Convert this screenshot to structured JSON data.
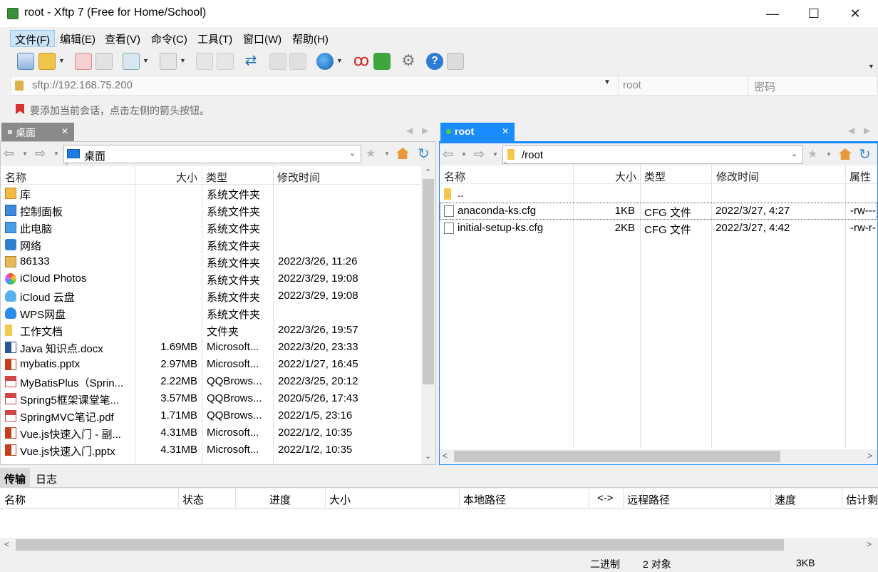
{
  "window": {
    "title": "root - Xftp 7 (Free for Home/School)"
  },
  "menu": [
    "文件(F)",
    "编辑(E)",
    "查看(V)",
    "命令(C)",
    "工具(T)",
    "窗口(W)",
    "帮助(H)"
  ],
  "address": {
    "url": "sftp://192.168.75.200",
    "user_placeholder": "root",
    "password_placeholder": "密码"
  },
  "hint": "要添加当前会话，点击左侧的箭头按钮。",
  "left": {
    "tab": "桌面",
    "path": "桌面",
    "columns": [
      "名称",
      "大小",
      "类型",
      "修改时间"
    ],
    "rows": [
      {
        "name": "库",
        "size": "",
        "type": "系统文件夹",
        "time": "",
        "icon": "library-icon"
      },
      {
        "name": "控制面板",
        "size": "",
        "type": "系统文件夹",
        "time": "",
        "icon": "control-panel-icon"
      },
      {
        "name": "此电脑",
        "size": "",
        "type": "系统文件夹",
        "time": "",
        "icon": "computer-icon"
      },
      {
        "name": "网络",
        "size": "",
        "type": "系统文件夹",
        "time": "",
        "icon": "network-icon"
      },
      {
        "name": "86133",
        "size": "",
        "type": "系统文件夹",
        "time": "2022/3/26, 11:26",
        "icon": "user-folder-icon"
      },
      {
        "name": "iCloud Photos",
        "size": "",
        "type": "系统文件夹",
        "time": "2022/3/29, 19:08",
        "icon": "icloud-photos-icon"
      },
      {
        "name": "iCloud 云盘",
        "size": "",
        "type": "系统文件夹",
        "time": "2022/3/29, 19:08",
        "icon": "icloud-drive-icon"
      },
      {
        "name": "WPS网盘",
        "size": "",
        "type": "系统文件夹",
        "time": "",
        "icon": "wps-cloud-icon"
      },
      {
        "name": "工作文档",
        "size": "",
        "type": "文件夹",
        "time": "2022/3/26, 19:57",
        "icon": "folder-icon"
      },
      {
        "name": "Java 知识点.docx",
        "size": "1.69MB",
        "type": "Microsoft...",
        "time": "2022/3/20, 23:33",
        "icon": "word-file-icon"
      },
      {
        "name": "mybatis.pptx",
        "size": "2.97MB",
        "type": "Microsoft...",
        "time": "2022/1/27, 16:45",
        "icon": "ppt-file-icon"
      },
      {
        "name": "MyBatisPlus（Sprin...",
        "size": "2.22MB",
        "type": "QQBrows...",
        "time": "2022/3/25, 20:12",
        "icon": "pdf-file-icon"
      },
      {
        "name": "Spring5框架课堂笔...",
        "size": "3.57MB",
        "type": "QQBrows...",
        "time": "2020/5/26, 17:43",
        "icon": "pdf-file-icon"
      },
      {
        "name": "SpringMVC笔记.pdf",
        "size": "1.71MB",
        "type": "QQBrows...",
        "time": "2022/1/5, 23:16",
        "icon": "pdf-file-icon"
      },
      {
        "name": "Vue.js快速入门 - 副...",
        "size": "4.31MB",
        "type": "Microsoft...",
        "time": "2022/1/2, 10:35",
        "icon": "ppt-file-icon"
      },
      {
        "name": "Vue.js快速入门.pptx",
        "size": "4.31MB",
        "type": "Microsoft...",
        "time": "2022/1/2, 10:35",
        "icon": "ppt-file-icon"
      }
    ]
  },
  "right": {
    "tab": "root",
    "path": "/root",
    "columns": [
      "名称",
      "大小",
      "类型",
      "修改时间",
      "属性"
    ],
    "rows": [
      {
        "name": "..",
        "size": "",
        "type": "",
        "time": "",
        "attr": "",
        "icon": "folder-icon"
      },
      {
        "name": "anaconda-ks.cfg",
        "size": "1KB",
        "type": "CFG 文件",
        "time": "2022/3/27, 4:27",
        "attr": "-rw---",
        "icon": "file-icon"
      },
      {
        "name": "initial-setup-ks.cfg",
        "size": "2KB",
        "type": "CFG 文件",
        "time": "2022/3/27, 4:42",
        "attr": "-rw-r-",
        "icon": "file-icon"
      }
    ]
  },
  "transfer": {
    "tabs": [
      "传输",
      "日志"
    ],
    "columns": [
      "名称",
      "状态",
      "进度",
      "大小",
      "本地路径",
      "<->",
      "远程路径",
      "速度",
      "估计剩"
    ]
  },
  "status": {
    "mode": "二进制",
    "objects": "2 对象",
    "size": "3KB"
  },
  "colors": {
    "accent": "#0078d7",
    "active_tab": "#1a8cff"
  }
}
